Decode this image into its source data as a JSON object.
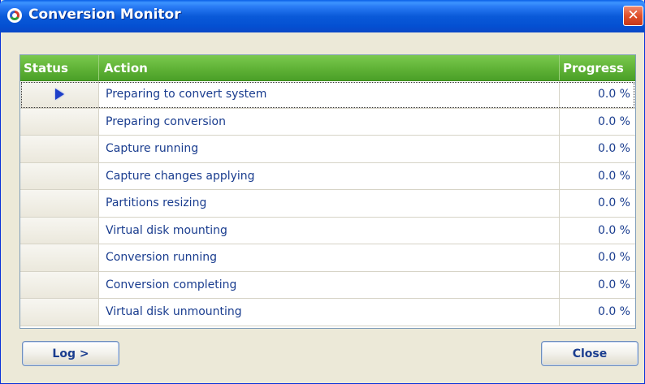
{
  "window": {
    "title": "Conversion Monitor",
    "close_glyph": "✕"
  },
  "table": {
    "headers": {
      "status": "Status",
      "action": "Action",
      "progress": "Progress"
    },
    "rows": [
      {
        "status_icon": "play-arrow-icon",
        "action": "Preparing to convert system",
        "progress": "0.0 %"
      },
      {
        "status_icon": "",
        "action": "Preparing conversion",
        "progress": "0.0 %"
      },
      {
        "status_icon": "",
        "action": "Capture running",
        "progress": "0.0 %"
      },
      {
        "status_icon": "",
        "action": "Capture changes applying",
        "progress": "0.0 %"
      },
      {
        "status_icon": "",
        "action": "Partitions resizing",
        "progress": "0.0 %"
      },
      {
        "status_icon": "",
        "action": "Virtual disk mounting",
        "progress": "0.0 %"
      },
      {
        "status_icon": "",
        "action": "Conversion running",
        "progress": "0.0 %"
      },
      {
        "status_icon": "",
        "action": "Conversion completing",
        "progress": "0.0 %"
      },
      {
        "status_icon": "",
        "action": "Virtual disk unmounting",
        "progress": "0.0 %"
      }
    ]
  },
  "buttons": {
    "log": "Log >",
    "close": "Close"
  },
  "colors": {
    "header_green": "#5fb236",
    "titlebar_blue": "#0a5ad9",
    "close_red": "#e0502a",
    "text_blue": "#1a3d8f",
    "play_icon_blue": "#1e3fc9"
  }
}
